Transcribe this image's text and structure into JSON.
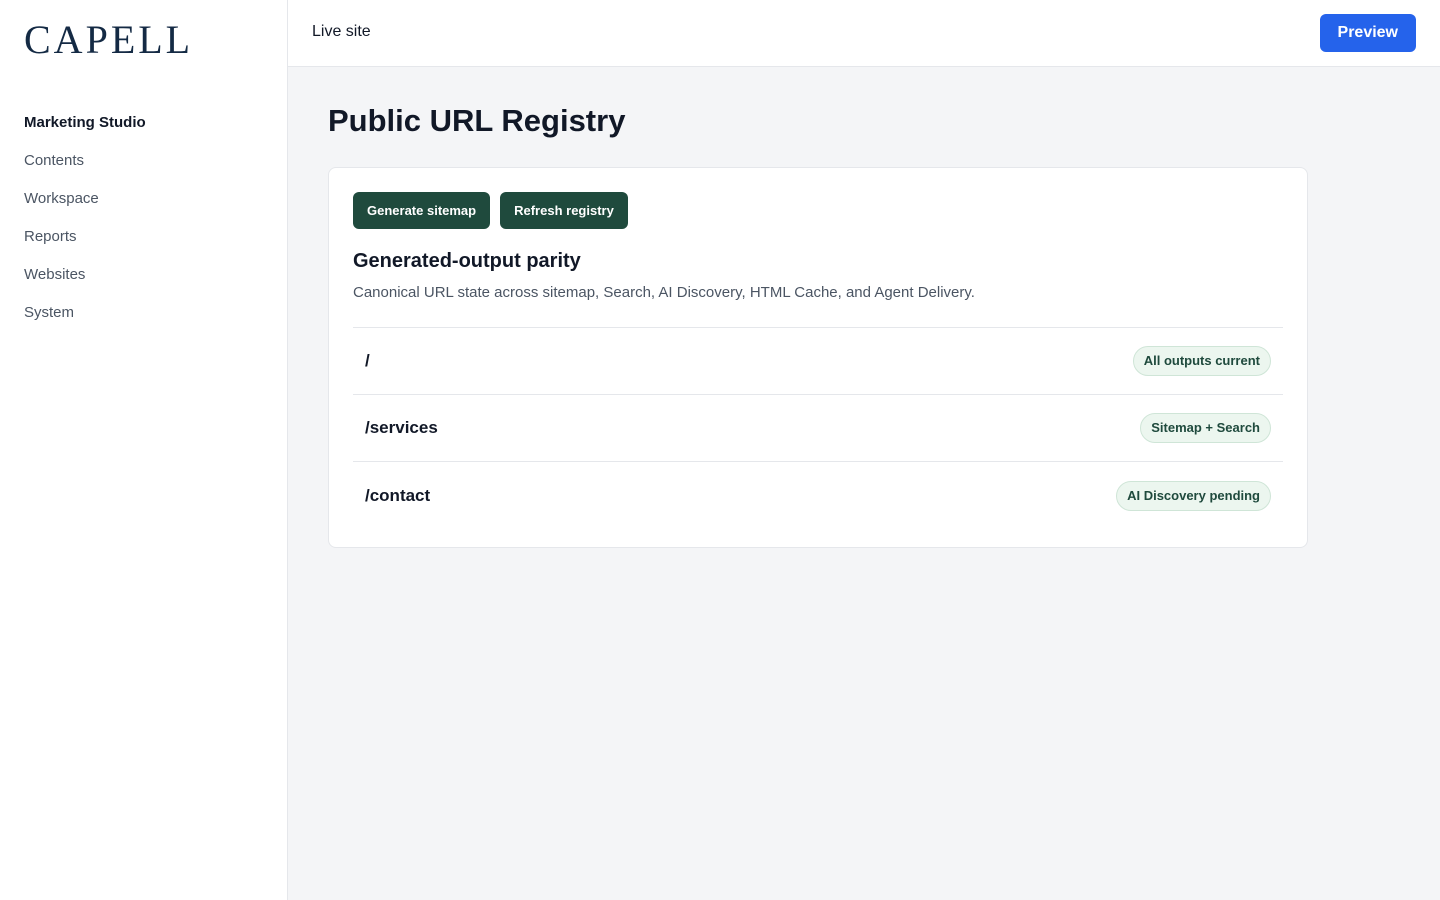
{
  "sidebar": {
    "logo": "CAPELL",
    "items": [
      {
        "label": "Marketing Studio",
        "active": true
      },
      {
        "label": "Contents"
      },
      {
        "label": "Workspace"
      },
      {
        "label": "Reports"
      },
      {
        "label": "Websites"
      },
      {
        "label": "System"
      }
    ]
  },
  "topbar": {
    "live_site": "Live site",
    "preview_label": "Preview"
  },
  "main": {
    "title": "Public URL Registry",
    "actions": {
      "generate_sitemap": "Generate sitemap",
      "refresh_registry": "Refresh registry"
    },
    "section": {
      "title": "Generated-output parity",
      "description": "Canonical URL state across sitemap, Search, AI Discovery, HTML Cache, and Agent Delivery."
    },
    "rows": [
      {
        "path": "/",
        "status": "All outputs current"
      },
      {
        "path": "/services",
        "status": "Sitemap + Search"
      },
      {
        "path": "/contact",
        "status": "AI Discovery pending"
      }
    ]
  },
  "colors": {
    "primary": "#2563eb",
    "dark_button": "#1f4a3d",
    "badge_bg": "#ecf6ef",
    "logo": "#142a44"
  }
}
